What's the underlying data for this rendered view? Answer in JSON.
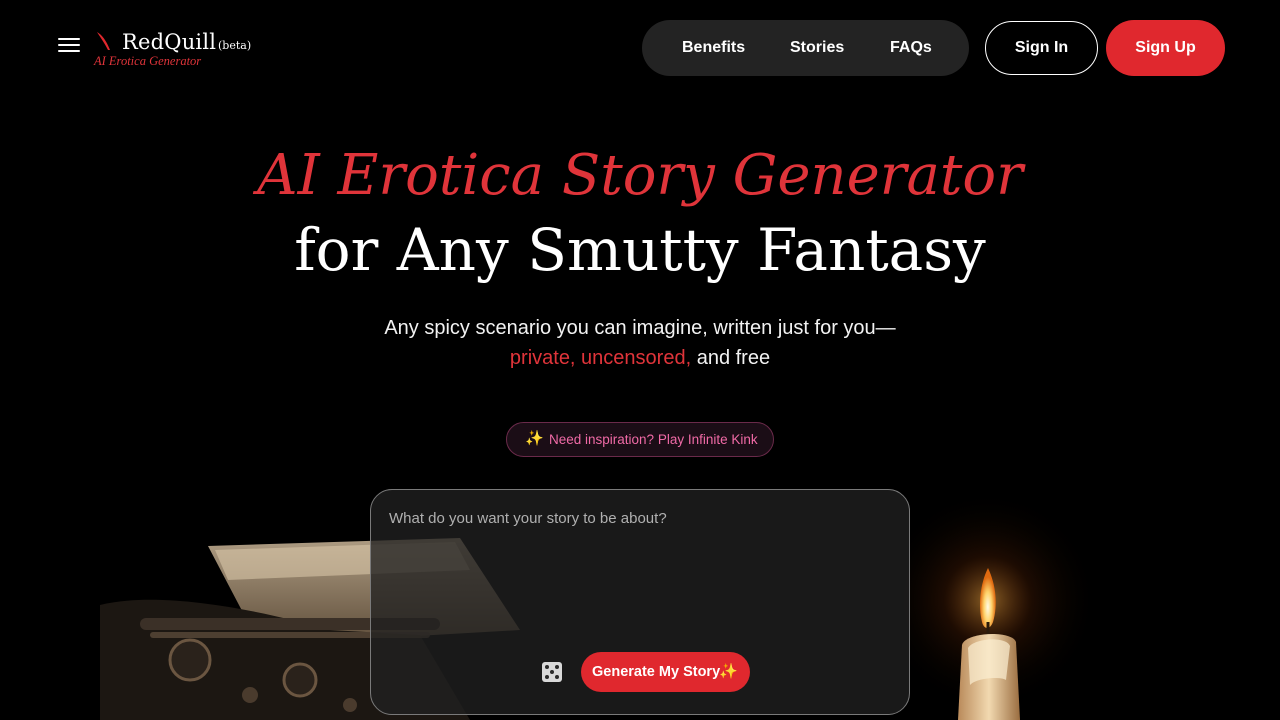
{
  "header": {
    "logo": {
      "name": "RedQuill",
      "badge": "(beta)",
      "tagline": "AI Erotica Generator"
    },
    "nav": [
      {
        "label": "Benefits"
      },
      {
        "label": "Stories"
      },
      {
        "label": "FAQs"
      }
    ],
    "signin_label": "Sign In",
    "signup_label": "Sign Up"
  },
  "hero": {
    "title_line1": "AI Erotica Story Generator",
    "title_line2": "for Any Smutty Fantasy",
    "subtitle_line1": "Any spicy scenario you can imagine, written just for you—",
    "subtitle_highlight": "private, uncensored,",
    "subtitle_end": "and free",
    "inspiration_label": "Need inspiration? Play Infinite Kink"
  },
  "prompt": {
    "placeholder": "What do you want your story to be about?",
    "value": "",
    "generate_label": "Generate My Story"
  },
  "icons": {
    "menu": "hamburger-menu-icon",
    "quill": "quill-icon",
    "sparkle": "sparkles-icon",
    "dice": "dice-icon"
  },
  "colors": {
    "background": "#000000",
    "accent_red": "#e0282e",
    "nav_pill": "#232323",
    "inspiration_text": "#f06aa6"
  }
}
